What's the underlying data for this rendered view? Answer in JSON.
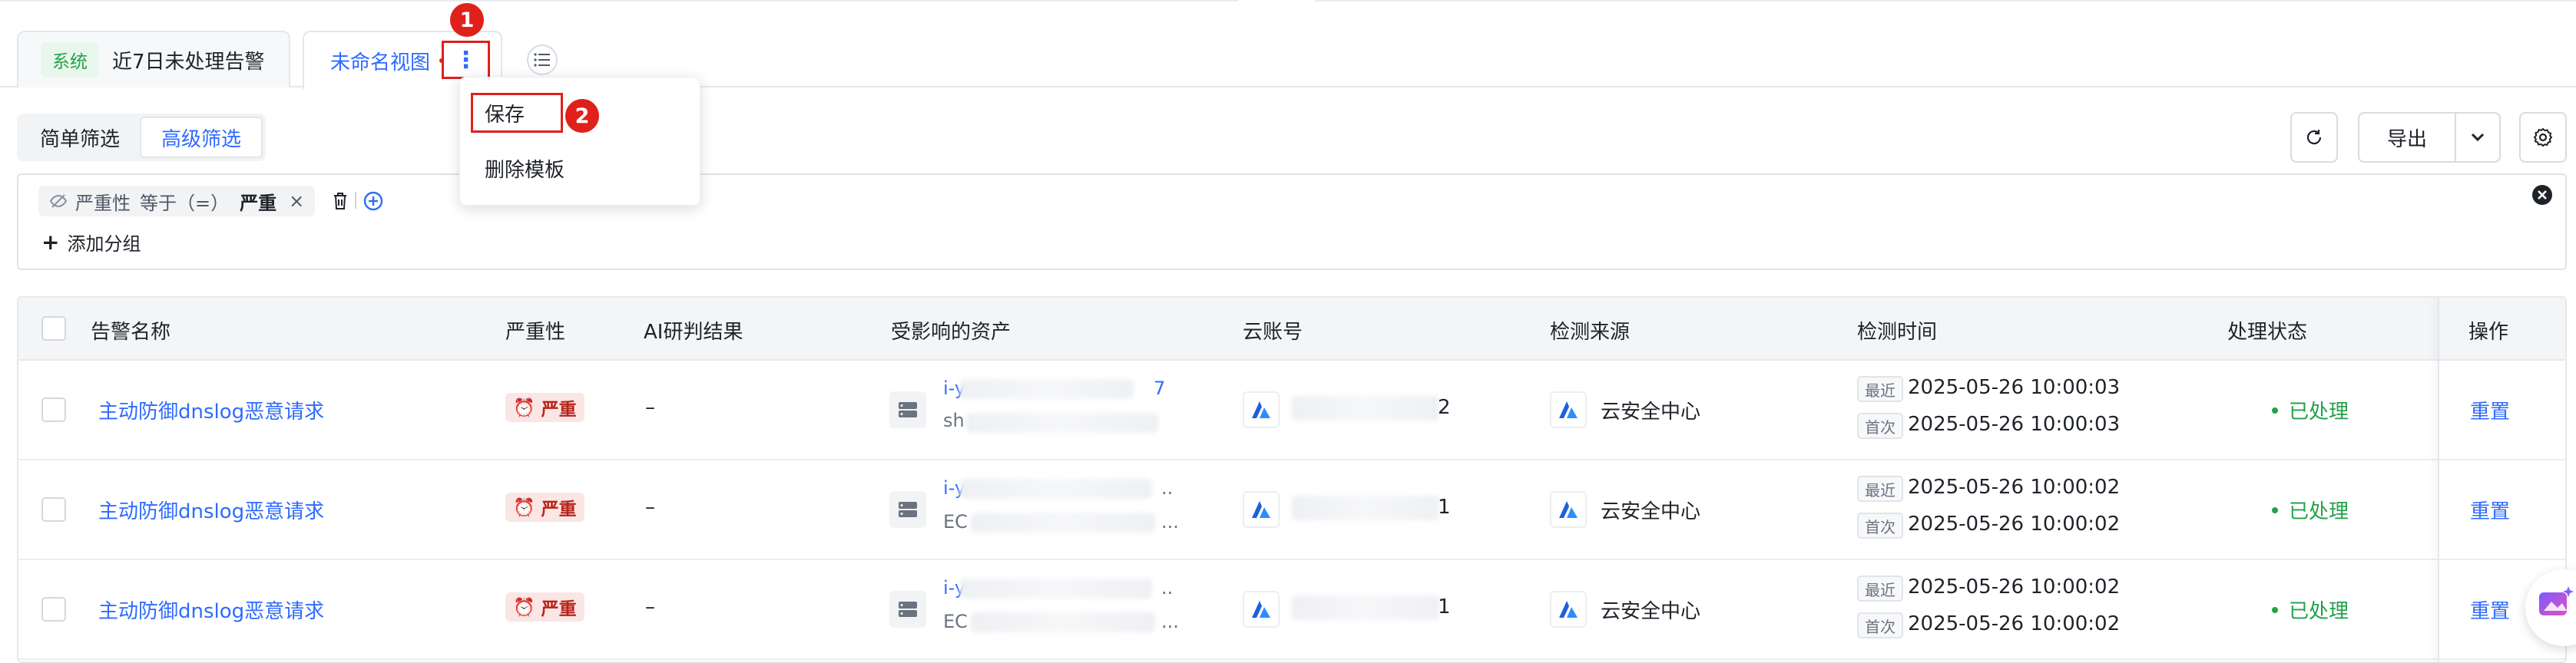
{
  "tabs": {
    "system_tag": "系统",
    "tab1_label": "近7日未处理告警",
    "tab2_label": "未命名视图",
    "more_glyph": "⋮"
  },
  "annotations": {
    "badge1": "1",
    "badge2": "2"
  },
  "menu": {
    "save": "保存",
    "delete_template": "删除模板"
  },
  "filter_mode": {
    "simple": "简单筛选",
    "advanced": "高级筛选"
  },
  "filter": {
    "field": "严重性",
    "operator": "等于（=）",
    "value": "严重",
    "add_group": "添加分组"
  },
  "toolbar": {
    "export": "导出"
  },
  "columns": [
    "告警名称",
    "严重性",
    "AI研判结果",
    "受影响的资产",
    "云账号",
    "检测来源",
    "检测时间",
    "处理状态",
    "操作"
  ],
  "rows": [
    {
      "name": "主动防御dnslog恶意请求",
      "severity": "严重",
      "ai_result": "–",
      "asset_line1_prefix": "i-y",
      "asset_line1_suffix": "7",
      "asset_line2_prefix": "sh",
      "account_suffix": "2",
      "source": "云安全中心",
      "recent_label": "最近",
      "recent_time": "2025-05-26 10:00:03",
      "first_label": "首次",
      "first_time": "2025-05-26 10:00:03",
      "status": "已处理",
      "action": "重置"
    },
    {
      "name": "主动防御dnslog恶意请求",
      "severity": "严重",
      "ai_result": "–",
      "asset_line1_prefix": "i-y",
      "asset_line1_suffix": "..",
      "asset_line2_prefix": "EC",
      "asset_line2_suffix": "...",
      "account_suffix": "1",
      "source": "云安全中心",
      "recent_label": "最近",
      "recent_time": "2025-05-26 10:00:02",
      "first_label": "首次",
      "first_time": "2025-05-26 10:00:02",
      "status": "已处理",
      "action": "重置"
    },
    {
      "name": "主动防御dnslog恶意请求",
      "severity": "严重",
      "ai_result": "–",
      "asset_line1_prefix": "i-y",
      "asset_line1_suffix": "..",
      "asset_line2_prefix": "EC",
      "asset_line2_suffix": "...",
      "account_suffix": "1",
      "source": "云安全中心",
      "recent_label": "最近",
      "recent_time": "2025-05-26 10:00:02",
      "first_label": "首次",
      "first_time": "2025-05-26 10:00:02",
      "status": "已处理",
      "action": "重置"
    }
  ],
  "colors": {
    "accent": "#2f6bff",
    "danger": "#e0201b",
    "success": "#23a148"
  }
}
